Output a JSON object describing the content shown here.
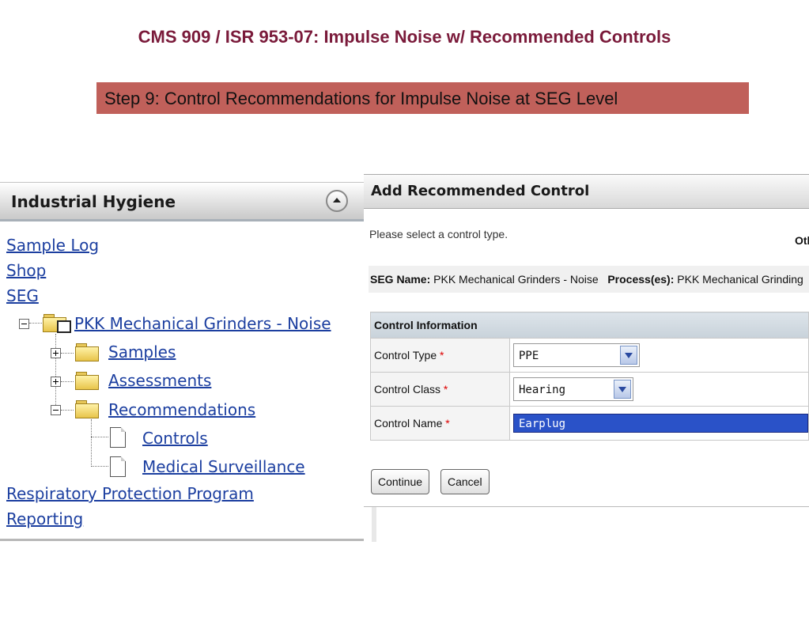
{
  "slide": {
    "title": "CMS 909 / ISR 953-07: Impulse Noise w/ Recommended Controls",
    "step": "Step 9: Control Recommendations for Impulse Noise at SEG Level"
  },
  "left_panel": {
    "title": "Industrial Hygiene",
    "links": {
      "sample_log": "Sample Log",
      "shop": "Shop",
      "seg": "SEG",
      "seg_node": "PKK Mechanical Grinders - Noise",
      "samples": "Samples",
      "assessments": "Assessments",
      "recommendations": "Recommendations",
      "controls": "Controls",
      "medical_surveillance": "Medical Surveillance",
      "respiratory": "Respiratory Protection Program",
      "reporting": "Reporting"
    }
  },
  "right_panel": {
    "title": "Add Recommended Control",
    "instruction": "Please select a control type.",
    "truncated": "Otl",
    "seg_label": "SEG Name:",
    "seg_value": "PKK Mechanical Grinders - Noise",
    "process_label": "Process(es):",
    "process_value": "PKK Mechanical Grinding",
    "section": "Control Information",
    "required_mark": "*",
    "fields": {
      "control_type": {
        "label": "Control Type",
        "value": "PPE"
      },
      "control_class": {
        "label": "Control Class",
        "value": "Hearing"
      },
      "control_name": {
        "label": "Control Name",
        "value": "Earplug"
      }
    },
    "buttons": {
      "continue": "Continue",
      "cancel": "Cancel"
    }
  },
  "colors": {
    "title": "#7a1a3a",
    "banner": "#c0605a",
    "link": "#1c3fa0",
    "selection": "#2a52c8"
  }
}
